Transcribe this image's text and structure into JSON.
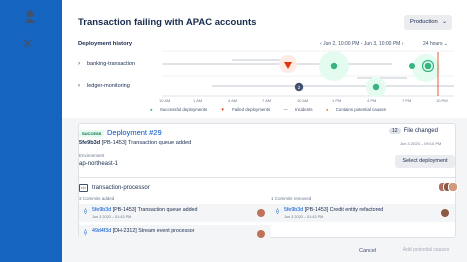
{
  "header": {
    "title": "Transaction failing with APAC accounts",
    "environment": "Production"
  },
  "history": {
    "label": "Deployment history",
    "range": "Jun 2, 10:00 PM - Jun 3, 10:00 PM",
    "window": "24 hours",
    "rows": [
      "banking-transaction",
      "ledger-monitoring"
    ],
    "ticks": [
      "10 AM",
      "1 AM",
      "4 AM",
      "7 AM",
      "10 AM",
      "1 PM",
      "4 PM",
      "7 PM",
      "10 PM"
    ],
    "incident_count": "2",
    "legend": {
      "success": "Successful deployments",
      "failed": "Failed deployments",
      "incidents": "Incidents",
      "causes": "Contains potential causes"
    },
    "colors": {
      "success": "#36b37e",
      "failed": "#de350b",
      "incident": "#42526e",
      "cause": "#ff8b00"
    }
  },
  "deployment": {
    "badge": "SUCCESS",
    "title": "Deployment #29",
    "commit_hash": "5fe9b3d",
    "commit_msg": "[PB-1453] Transaction queue added",
    "files_count": "12",
    "files_label": "File changed",
    "date": "Jun 3 2020 – 09:10 PM",
    "env_label": "Environment",
    "env_value": "ap-northeast-1",
    "select_label": "Select deployment"
  },
  "processor": {
    "name": "transaction-processor",
    "added_label": "3 Commits added",
    "removed_label": "1 Commits removed",
    "added": [
      {
        "hash": "5fe9b3d",
        "msg": "[PB-1453] Transaction queue added",
        "date": "Jun 3 2020 – 01:43 PM"
      },
      {
        "hash": "49d4f3d",
        "msg": "[DH-2312] Stream event processor",
        "date": ""
      }
    ],
    "removed": [
      {
        "hash": "5fe9b3d",
        "msg": "[PB-1453] Credit entity refactored",
        "date": "Jun 3 2020 – 01:43 PM"
      }
    ]
  },
  "footer": {
    "cancel": "Cancel",
    "add": "Add potential causes"
  }
}
